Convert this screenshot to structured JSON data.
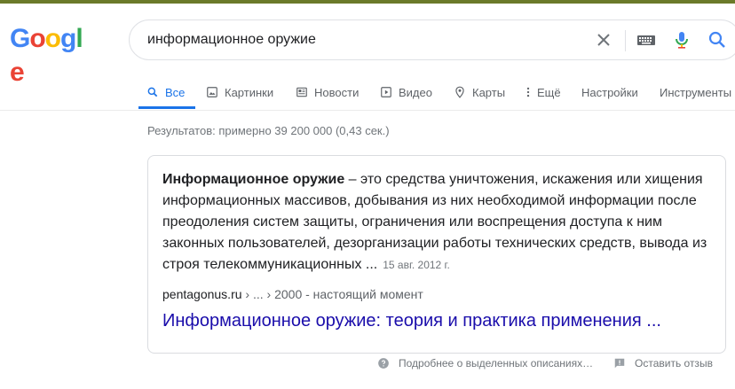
{
  "logo": {
    "letters": [
      "G",
      "o",
      "o",
      "g",
      "l",
      "e"
    ]
  },
  "search": {
    "query": "информационное оружие"
  },
  "tabs": [
    {
      "label": "Все",
      "icon": "search-icon"
    },
    {
      "label": "Картинки",
      "icon": "image-icon"
    },
    {
      "label": "Новости",
      "icon": "news-icon"
    },
    {
      "label": "Видео",
      "icon": "play-icon"
    },
    {
      "label": "Карты",
      "icon": "map-pin-icon"
    },
    {
      "label": "Ещё",
      "icon": "more-vert-icon"
    },
    {
      "label": "Настройки"
    },
    {
      "label": "Инструменты"
    }
  ],
  "stats": "Результатов: примерно 39 200 000 (0,43 сек.)",
  "snippet": {
    "bold": "Информационное оружие",
    "text": " – это средства уничтожения, искажения или хищения информационных массивов, добывания из них необходимой информации после преодоления систем защиты, ограничения или воспрещения доступа к ним законных пользователей, дезорганизации работы технических средств, вывода из строя телекоммуникационных ...",
    "date": "15 авг. 2012 г.",
    "site": "pentagonus.ru",
    "path": " › ... › 2000 - настоящий момент",
    "title": "Информационное оружие: теория и практика применения ..."
  },
  "footer": {
    "about": "Подробнее о выделенных описаниях…",
    "feedback": "Оставить отзыв"
  },
  "colors": {
    "accent": "#1a73e8",
    "link": "#1a0dab",
    "muted": "#70757a"
  }
}
